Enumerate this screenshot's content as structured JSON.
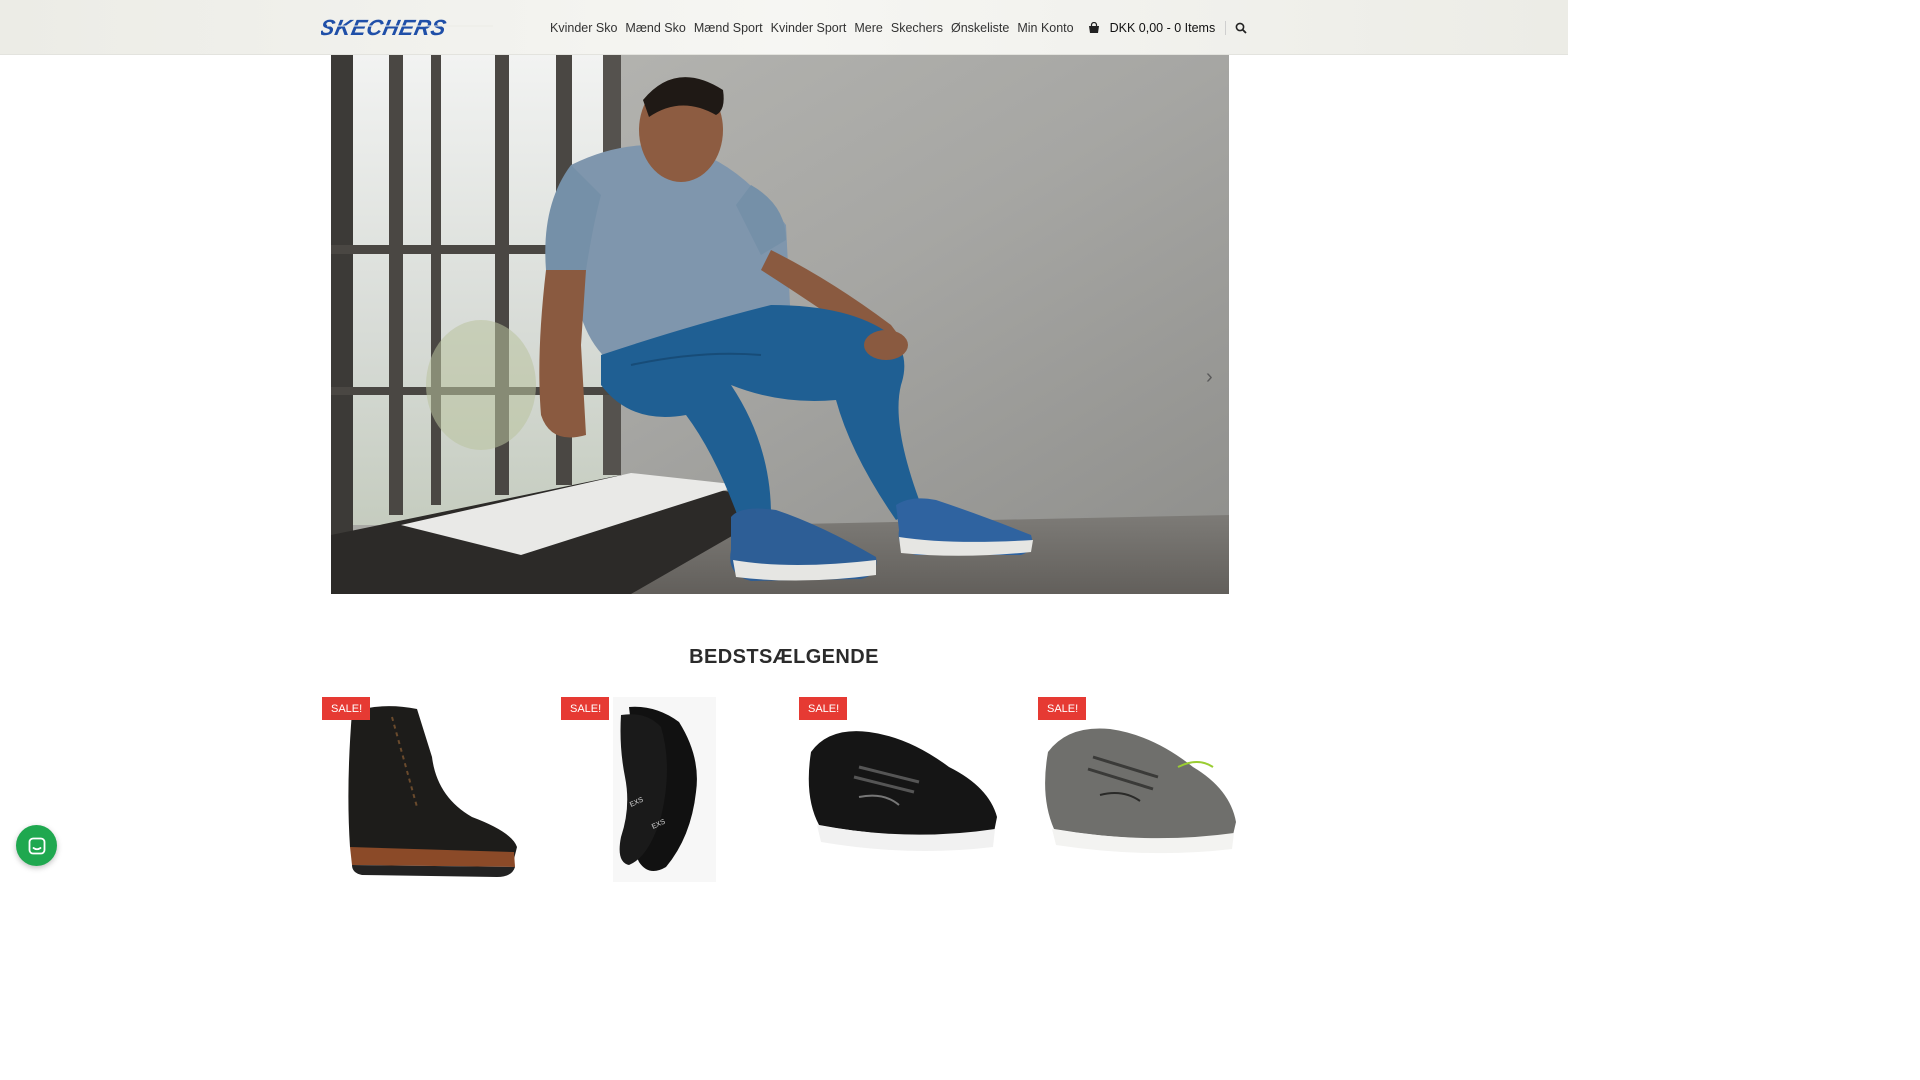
{
  "header": {
    "logo_text": "SKECHERS",
    "nav": [
      "Kvinder Sko",
      "Mænd Sko",
      "Mænd Sport",
      "Kvinder Sport",
      "Mere",
      "Skechers",
      "Ønskeliste",
      "Min Konto"
    ],
    "cart_text": "DKK 0,00 - 0 Items"
  },
  "hero": {
    "next_arrow": "›"
  },
  "section": {
    "title": "BEDSTSÆLGENDE"
  },
  "products": [
    {
      "badge": "SALE!"
    },
    {
      "badge": "SALE!"
    },
    {
      "badge": "SALE!"
    },
    {
      "badge": "SALE!"
    }
  ],
  "colors": {
    "brand_blue": "#1f4fa8",
    "sale_red": "#e63a33",
    "chat_green": "#1fa84f"
  },
  "icons": {
    "cart": "shopping-bag-icon",
    "search": "search-icon",
    "chat": "chat-icon"
  }
}
